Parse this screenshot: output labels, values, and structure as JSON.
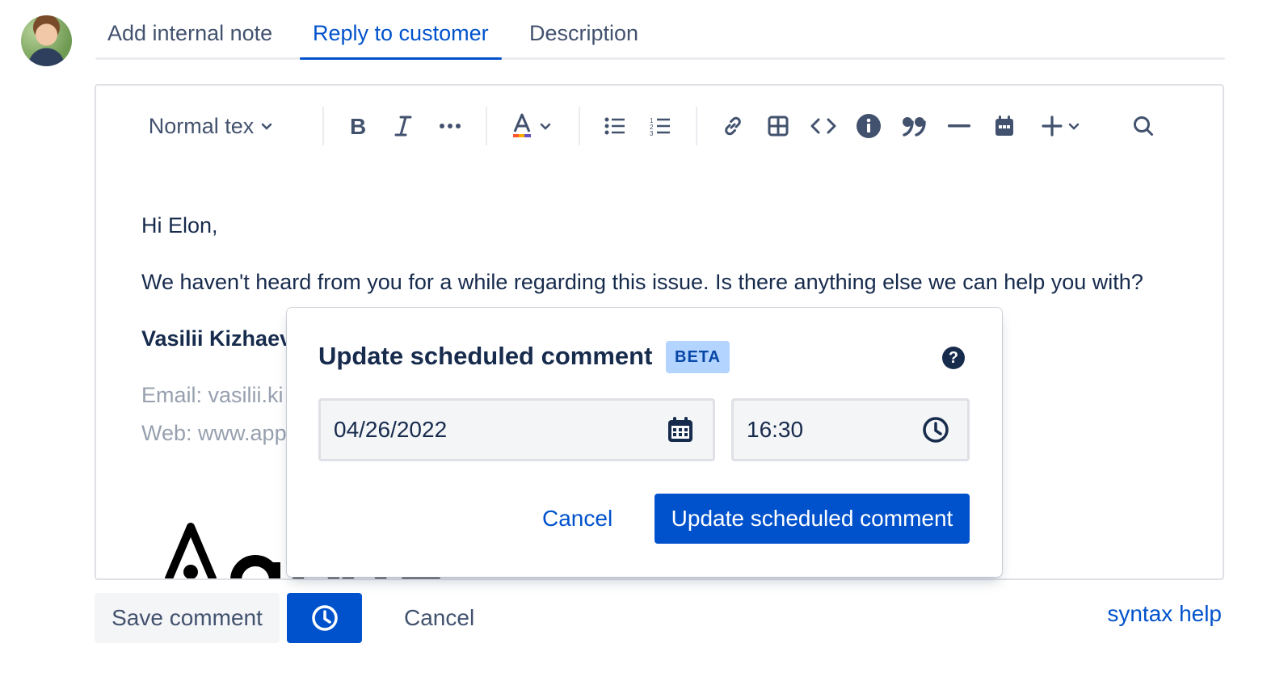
{
  "tabs": [
    {
      "label": "Add internal note"
    },
    {
      "label": "Reply to customer",
      "active": true
    },
    {
      "label": "Description"
    }
  ],
  "toolbar": {
    "text_style": "Normal tex",
    "icons": [
      "bold-icon",
      "italic-icon",
      "more-formatting-icon",
      "text-color-icon",
      "bullet-list-icon",
      "numbered-list-icon",
      "link-icon",
      "table-icon",
      "code-icon",
      "info-panel-icon",
      "quote-icon",
      "divider-icon",
      "date-icon",
      "insert-icon",
      "search-icon"
    ]
  },
  "editor": {
    "greeting": "Hi Elon,",
    "body": "We haven't heard from you for a while regarding this issue. Is there anything else we can help you with?",
    "signature_name": "Vasilii Kizhaev",
    "email_line": "Email: vasilii.ki",
    "web_line": "Web: www.app"
  },
  "popup": {
    "title": "Update scheduled comment",
    "badge": "BETA",
    "help_glyph": "?",
    "date_value": "04/26/2022",
    "time_value": "16:30",
    "cancel_label": "Cancel",
    "submit_label": "Update scheduled comment"
  },
  "actions": {
    "save_label": "Save comment",
    "cancel_label": "Cancel",
    "syntax_help_label": "syntax help"
  },
  "colors": {
    "primary": "#0052cc",
    "text": "#172b4d",
    "subtle_text": "#42526e",
    "muted_text": "#97a0af",
    "badge_bg": "#b3d4ff"
  }
}
